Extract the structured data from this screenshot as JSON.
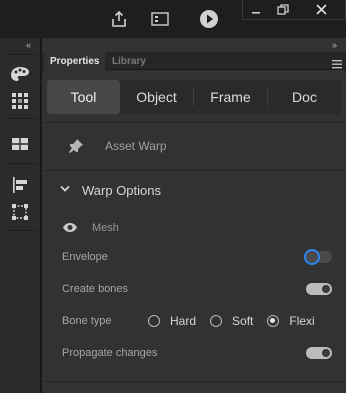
{
  "left_toolbar": {
    "collapse_glyph": "«",
    "tools": [
      "palette-icon",
      "swatches-grid-icon",
      "library-grid-icon",
      "align-icon",
      "transform-icon"
    ]
  },
  "window": {
    "icons": [
      "share-icon",
      "test-movie-icon",
      "play-icon"
    ],
    "controls": [
      "minimize-icon",
      "restore-icon",
      "close-icon"
    ]
  },
  "panel": {
    "collapse_glyph": "»",
    "tabs": [
      {
        "label": "Properties",
        "active": true
      },
      {
        "label": "Library",
        "active": false
      }
    ],
    "segments": [
      {
        "label": "Tool",
        "active": true
      },
      {
        "label": "Object",
        "active": false
      },
      {
        "label": "Frame",
        "active": false
      },
      {
        "label": "Doc",
        "active": false
      }
    ],
    "tool_name": "Asset Warp",
    "section_title": "Warp Options",
    "mesh_label": "Mesh",
    "envelope": {
      "label": "Envelope",
      "on": false
    },
    "create_bones": {
      "label": "Create bones",
      "on": true
    },
    "bone_type": {
      "label": "Bone type",
      "options": [
        {
          "label": "Hard",
          "selected": false
        },
        {
          "label": "Soft",
          "selected": false
        },
        {
          "label": "Flexi",
          "selected": true
        }
      ]
    },
    "propagate_changes": {
      "label": "Propagate changes",
      "on": true
    }
  }
}
